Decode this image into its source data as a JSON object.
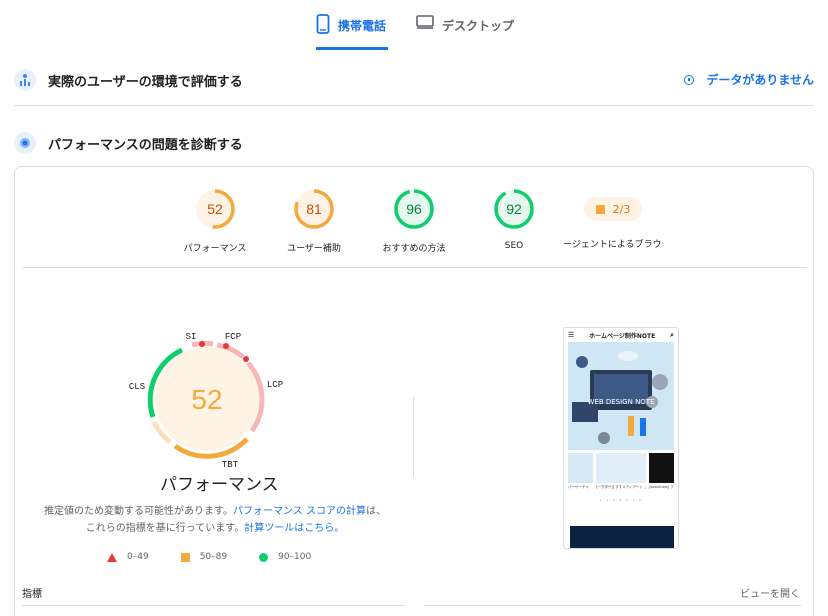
{
  "tabs": [
    {
      "label": "携帯電話",
      "active": true
    },
    {
      "label": "デスクトップ",
      "active": false
    }
  ],
  "sections": {
    "real_user": {
      "title": "実際のユーザーの環境で評価する",
      "status": "データがありません"
    },
    "diagnose": {
      "title": "パフォーマンスの問題を診断する"
    }
  },
  "scores": [
    {
      "label": "パフォーマンス",
      "value": "52",
      "status": "average"
    },
    {
      "label": "ユーザー補助",
      "value": "81",
      "status": "average"
    },
    {
      "label": "おすすめの方法",
      "value": "96",
      "status": "pass"
    },
    {
      "label": "SEO",
      "value": "92",
      "status": "pass"
    }
  ],
  "agent": {
    "label": "ージェントによるブラウジン",
    "value": "2/3"
  },
  "main_gauge": {
    "value": "52",
    "title": "パフォーマンス",
    "metric_labels": {
      "si": "SI",
      "fcp": "FCP",
      "lcp": "LCP",
      "tbt": "TBT",
      "cls": "CLS"
    }
  },
  "note": {
    "part1": "推定値のため変動する可能性があります。",
    "link1": "パフォーマンス スコアの計算",
    "part2": "は、これらの指標を基に行っています。",
    "link2": "計算ツールはこちら。"
  },
  "legend": [
    {
      "range": "0–49",
      "color": "#e53935"
    },
    {
      "range": "50–89",
      "color": "#f4a93c"
    },
    {
      "range": "90–100",
      "color": "#0cce6b"
    }
  ],
  "preview": {
    "site_title": "ホームページ制作NOTE",
    "hero_text": "WEB DESIGN NOTE",
    "captions": [
      "パーサーチャ",
      "[一方学サ]] すすメディアート ュ [ahovesdone] スアイズも",
      "[aboutnow] ファランガル酸 化"
    ]
  },
  "footer": {
    "metrics": "指標",
    "view": "ビューを開く"
  },
  "colors": {
    "accent": "#1a73e8",
    "average": "#f4a93c",
    "pass": "#0cce6b",
    "fail": "#e53935"
  }
}
